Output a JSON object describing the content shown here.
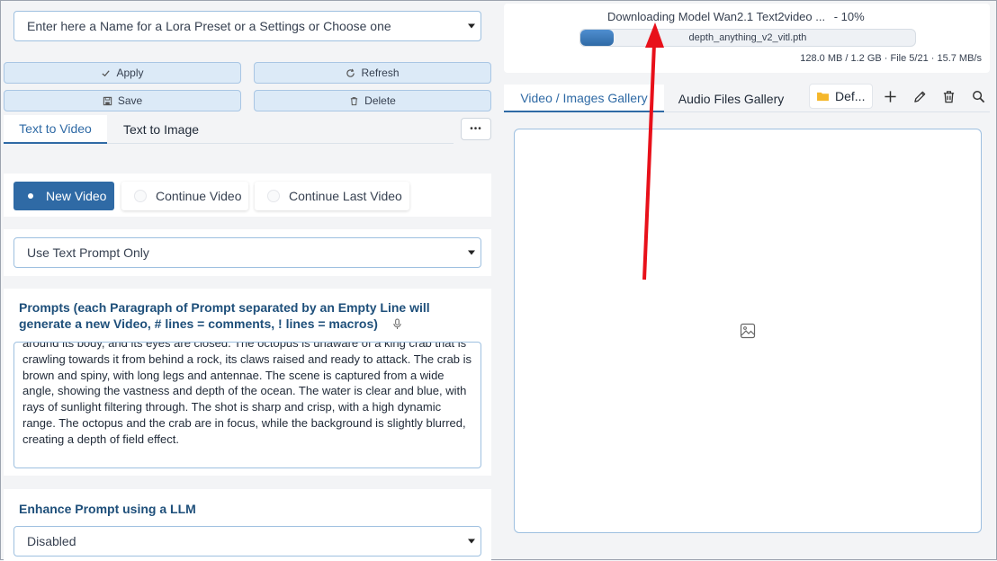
{
  "preset": {
    "placeholder": "Enter here a Name for a Lora Preset or a Settings or Choose one"
  },
  "buttons": {
    "apply": "Apply",
    "refresh": "Refresh",
    "save": "Save",
    "delete": "Delete"
  },
  "mode_tabs": [
    {
      "label": "Text to Video",
      "active": true
    },
    {
      "label": "Text to Image",
      "active": false
    }
  ],
  "more_label": "•••",
  "video_mode": {
    "options": [
      "New Video",
      "Continue Video",
      "Continue Last Video"
    ],
    "selected": "New Video"
  },
  "prompt_source": {
    "value": "Use Text Prompt Only"
  },
  "prompts": {
    "label": "Prompts (each Paragraph of Prompt separated by an Empty Line will generate a new Video, # lines = comments, ! lines = macros)",
    "text": "around its body, and its eyes are closed. The octopus is unaware of a king crab that is crawling towards it from behind a rock, its claws raised and ready to attack. The crab is brown and spiny, with long legs and antennae. The scene is captured from a wide angle, showing the vastness and depth of the ocean. The water is clear and blue, with rays of sunlight filtering through. The shot is sharp and crisp, with a high dynamic range. The octopus and the crab are in focus, while the background is slightly blurred, creating a depth of field effect."
  },
  "enhance": {
    "label": "Enhance Prompt using a LLM",
    "value": "Disabled"
  },
  "download": {
    "title": "Downloading Model Wan2.1 Text2video ...",
    "percent_text": "- 10%",
    "progress": 0.1,
    "file": "depth_anything_v2_vitl.pth",
    "stats": "128.0 MB / 1.2 GB · File 5/21 · 15.7 MB/s"
  },
  "gallery": {
    "tabs": [
      {
        "label": "Video / Images Gallery",
        "active": true
      },
      {
        "label": "Audio Files Gallery",
        "active": false
      }
    ],
    "folder": "Def...",
    "accent": "#2f6aa5"
  },
  "annotation": {
    "arrow_color": "#e8101a"
  }
}
